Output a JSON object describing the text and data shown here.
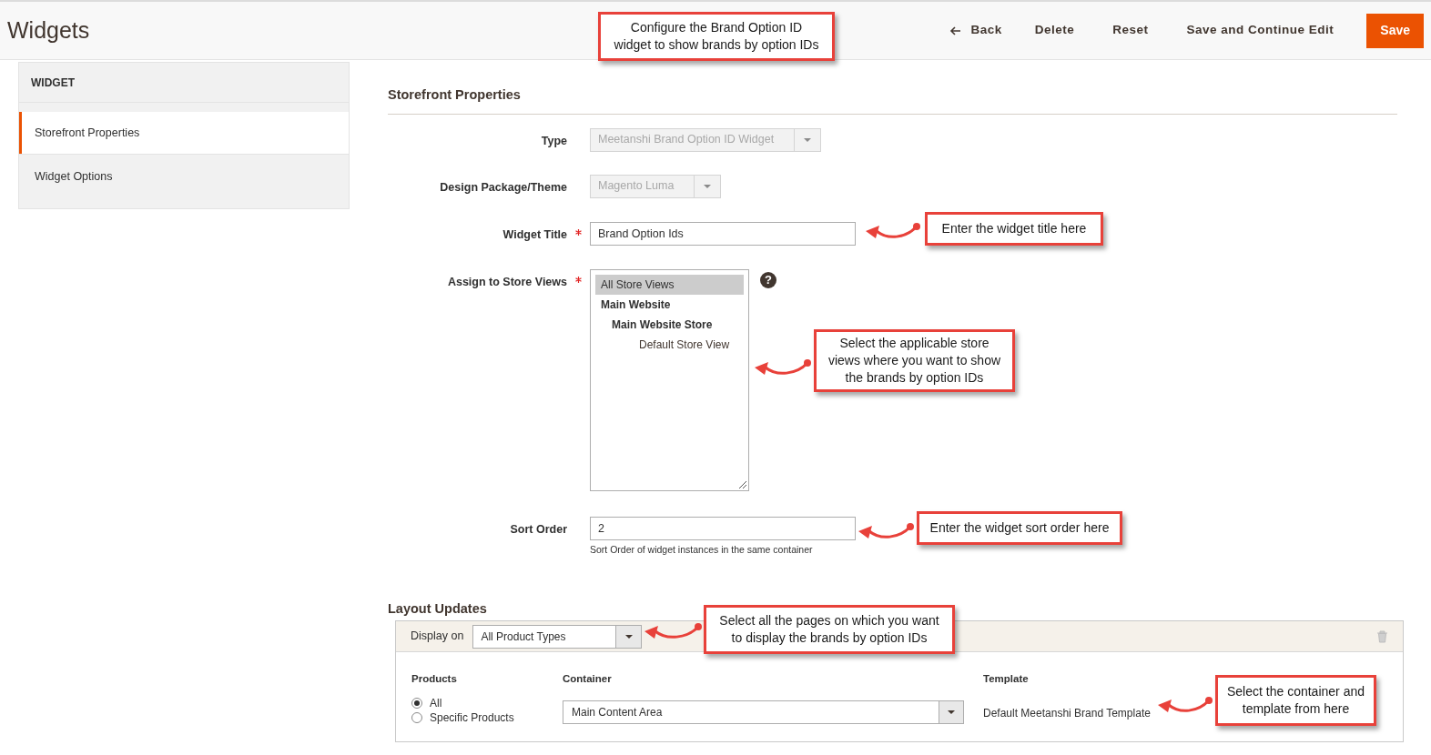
{
  "header": {
    "title": "Widgets",
    "actions": [
      {
        "label": "Back",
        "kind": "back"
      },
      {
        "label": "Delete",
        "kind": "link"
      },
      {
        "label": "Reset",
        "kind": "link"
      },
      {
        "label": "Save and Continue Edit",
        "kind": "link"
      },
      {
        "label": "Save",
        "kind": "primary"
      }
    ]
  },
  "sidebar": {
    "heading": "WIDGET",
    "items": [
      {
        "label": "Storefront Properties",
        "selected": true
      },
      {
        "label": "Widget Options",
        "selected": false
      }
    ]
  },
  "storefront": {
    "title": "Storefront Properties",
    "fields": [
      {
        "kind": "select",
        "label": "Type",
        "value": "Meetanshi Brand Option ID Widget",
        "required": false,
        "disabled": true
      },
      {
        "kind": "select",
        "label": "Design Package/Theme",
        "value": "Magento Luma",
        "required": false,
        "disabled": true
      },
      {
        "kind": "text",
        "label": "Widget Title",
        "value": "Brand Option Ids",
        "required": true,
        "disabled": false
      },
      {
        "kind": "multiselect",
        "label": "Assign to Store Views",
        "required": true,
        "disabled": false,
        "help": "?",
        "options": [
          {
            "label": "All Store Views",
            "selected": true
          },
          {
            "label": "Main Website",
            "selected": false,
            "children": [
              {
                "label": "Main Website Store",
                "selected": false,
                "children": [
                  {
                    "label": "Default Store View",
                    "selected": false
                  }
                ]
              }
            ]
          }
        ]
      },
      {
        "kind": "text",
        "label": "Sort Order",
        "value": "2",
        "note": "Sort Order of widget instances in the same container",
        "required": false,
        "disabled": false
      }
    ]
  },
  "layout_updates": {
    "title": "Layout Updates",
    "display_on": {
      "label": "Display on",
      "value": "All Product Types"
    },
    "products": {
      "label": "Products",
      "options": [
        {
          "label": "All",
          "selected": true
        },
        {
          "label": "Specific Products",
          "selected": false
        }
      ]
    },
    "container": {
      "label": "Container",
      "value": "Main Content Area"
    },
    "template": {
      "label": "Template",
      "value": "Default Meetanshi Brand Template"
    }
  },
  "annotations": [
    {
      "text": "Configure the Brand Option ID widget to show brands by option IDs"
    },
    {
      "text": "Enter the widget title here"
    },
    {
      "text": "Select the applicable store views where you want to show the brands by option IDs"
    },
    {
      "text": "Enter the widget sort order here"
    },
    {
      "text": "Select all the pages on which you want to display the brands by option IDs"
    },
    {
      "text": "Select the container and template from here"
    }
  ]
}
